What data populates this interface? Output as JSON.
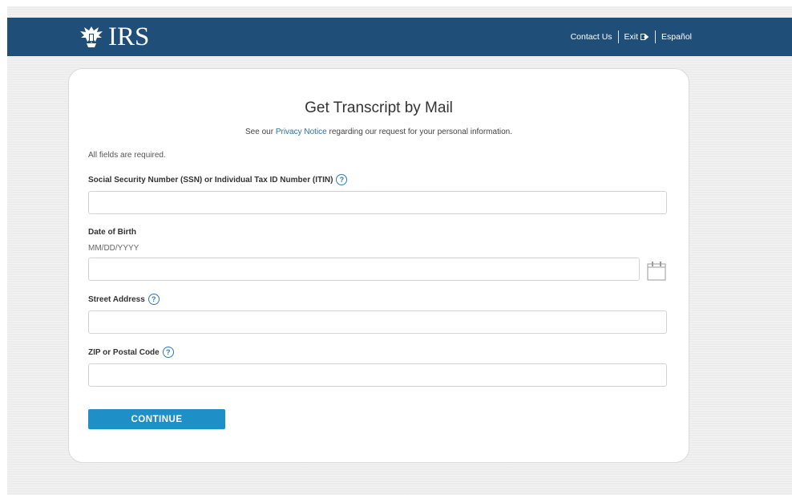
{
  "header": {
    "logo_text": "IRS",
    "logo_icon": "eagle-icon",
    "nav": {
      "contact_label": "Contact Us",
      "exit_label": "Exit",
      "exit_icon": "exit-icon",
      "language_label": "Español"
    }
  },
  "form": {
    "title": "Get Transcript by Mail",
    "subtitle_prefix": "See our ",
    "subtitle_link": "Privacy Notice",
    "subtitle_suffix": " regarding our request for your personal information.",
    "required_note": "All fields are required.",
    "fields": {
      "ssn": {
        "label": "Social Security Number (SSN) or Individual Tax ID Number (ITIN)",
        "value": "",
        "help_icon": "question-icon"
      },
      "dob": {
        "label": "Date of Birth",
        "hint": "MM/DD/YYYY",
        "value": "",
        "picker_icon": "calendar-icon"
      },
      "street": {
        "label": "Street Address",
        "value": "",
        "help_icon": "question-icon"
      },
      "zip": {
        "label": "ZIP or Postal Code",
        "value": "",
        "help_icon": "question-icon"
      }
    },
    "help_glyph": "?",
    "continue_label": "CONTINUE"
  },
  "colors": {
    "header_bg": "#1f4e79",
    "button_bg": "#1e8fc7",
    "link": "#2c6fb0"
  }
}
